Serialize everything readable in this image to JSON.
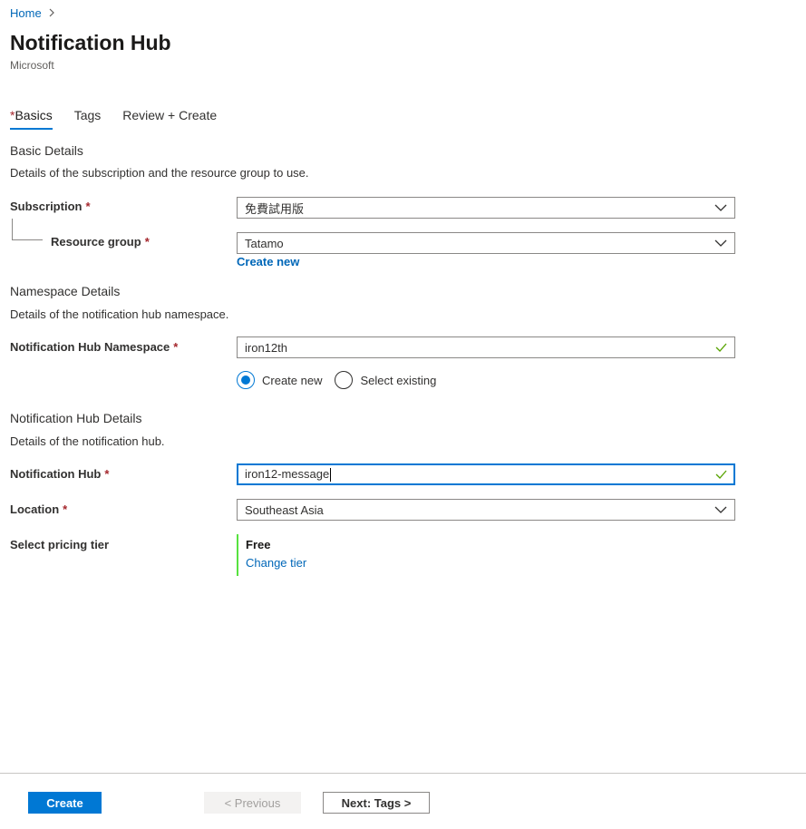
{
  "breadcrumb": {
    "home": "Home",
    "separator": ">"
  },
  "page": {
    "title": "Notification Hub",
    "subtitle": "Microsoft"
  },
  "tabs": [
    {
      "label": "Basics",
      "required": "*",
      "active": true
    },
    {
      "label": "Tags"
    },
    {
      "label": "Review + Create"
    }
  ],
  "basic_details": {
    "heading": "Basic Details",
    "description": "Details of the subscription and the resource group to use.",
    "subscription": {
      "label": "Subscription",
      "required": "*",
      "value": "免費試用版"
    },
    "resource_group": {
      "label": "Resource group",
      "required": "*",
      "value": "Tatamo",
      "create_new": "Create new"
    }
  },
  "namespace_details": {
    "heading": "Namespace Details",
    "description": "Details of the notification hub namespace.",
    "namespace": {
      "label": "Notification Hub Namespace",
      "required": "*",
      "value": "iron12th"
    },
    "radio_create_new": "Create new",
    "radio_select_existing": "Select existing",
    "selected": "Create new"
  },
  "hub_details": {
    "heading": "Notification Hub Details",
    "description": "Details of the notification hub.",
    "hub": {
      "label": "Notification Hub",
      "required": "*",
      "value": "iron12-message"
    },
    "location": {
      "label": "Location",
      "required": "*",
      "value": "Southeast Asia"
    },
    "pricing": {
      "label": "Select pricing tier",
      "tier": "Free",
      "change": "Change tier"
    }
  },
  "footer": {
    "create": "Create",
    "previous": "< Previous",
    "next": "Next: Tags >"
  },
  "colors": {
    "accent": "#0078d4",
    "link": "#0067b8",
    "required": "#a4262c",
    "valid_check": "#57a300",
    "tier_border": "#57e23f"
  }
}
